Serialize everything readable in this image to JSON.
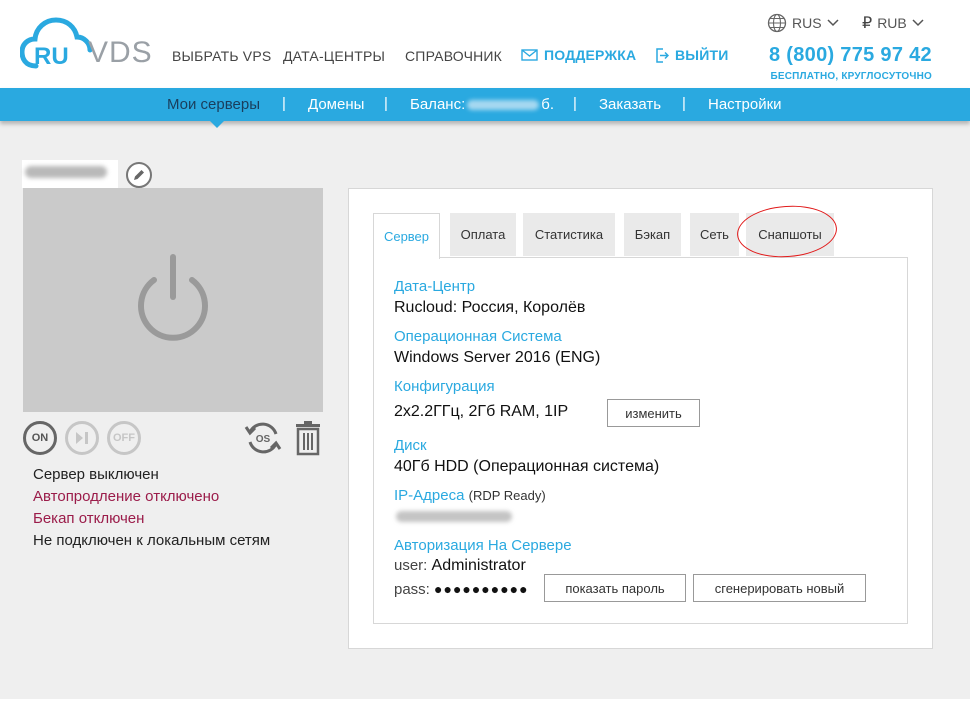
{
  "brand": {
    "logo_ru": "RU",
    "logo_vds": "VDS"
  },
  "nav": {
    "choose_vps": "ВЫБРАТЬ VPS",
    "datacenters": "ДАТА-ЦЕНТРЫ",
    "reference": "СПРАВОЧНИК",
    "support": "ПОДДЕРЖКА",
    "logout": "ВЫЙТИ"
  },
  "top": {
    "language": "RUS",
    "currency_symbol": "₽",
    "currency": "RUB",
    "phone": "8 (800) 775 97 42",
    "phone_note": "БЕСПЛАТНО, КРУГЛОСУТОЧНО"
  },
  "menu": {
    "my_servers": "Мои серверы",
    "domains": "Домены",
    "balance_prefix": "Баланс:",
    "balance_suffix": "б.",
    "order": "Заказать",
    "settings": "Настройки",
    "separator": "|"
  },
  "server": {
    "controls": {
      "on": "ON",
      "off": "OFF",
      "reinstall": "OS"
    },
    "status_lines": [
      "Сервер выключен",
      "Автопродление отключено",
      "Бекап отключен",
      "Не подключен к локальным сетям"
    ]
  },
  "tabs": [
    "Сервер",
    "Оплата",
    "Статистика",
    "Бэкап",
    "Сеть",
    "Снапшоты"
  ],
  "details": {
    "datacenter_label": "Дата-Центр",
    "datacenter_value": "Rucloud: Россия, Королёв",
    "os_label": "Операционная Система",
    "os_value": "Windows Server 2016 (ENG)",
    "config_label": "Конфигурация",
    "config_value": "2x2.2ГГц, 2Гб RAM, 1IP",
    "change_button": "изменить",
    "disk_label": "Диск",
    "disk_value": "40Гб HDD (Операционная система)",
    "ip_label": "IP-Адреса",
    "ip_note": "(RDP Ready)",
    "auth_label": "Авторизация На Сервере",
    "user_label": "user:",
    "user_value": "Administrator",
    "pass_label": "pass:",
    "pass_value": "●●●●●●●●●●",
    "show_password_button": "показать пароль",
    "generate_button": "сгенерировать новый"
  },
  "colors": {
    "accent": "#2aa9e0",
    "menu_active": "#1a3e5c",
    "warning_text": "#9b1c4a",
    "annotation": "#e11b1b"
  }
}
